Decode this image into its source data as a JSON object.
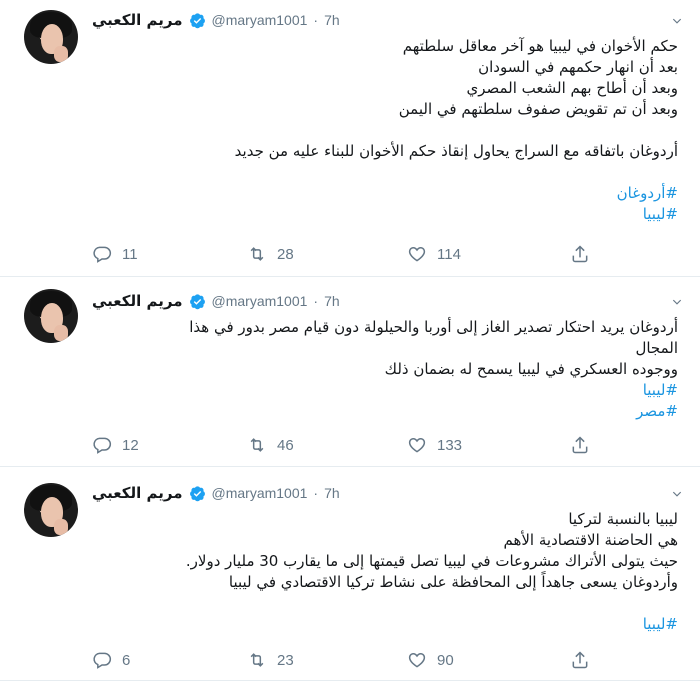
{
  "tweets": [
    {
      "author": {
        "name": "مريم الكعبي",
        "handle": "@maryam1001",
        "time": "7h"
      },
      "lines": [
        "حكم الأخوان في ليبيا هو آخر معاقل سلطتهم",
        "بعد أن انهار حكمهم في السودان",
        "وبعد أن أطاح بهم الشعب المصري",
        "وبعد أن تم تقويض صفوف سلطتهم في اليمن",
        "",
        "أردوغان باتفاقه مع السراج يحاول إنقاذ حكم الأخوان للبناء عليه من جديد",
        ""
      ],
      "hashtags": [
        "#أردوغان",
        "#ليبيا"
      ],
      "counts": {
        "replies": "11",
        "retweets": "28",
        "likes": "114"
      }
    },
    {
      "author": {
        "name": "مريم الكعبي",
        "handle": "@maryam1001",
        "time": "7h"
      },
      "lines": [
        "أردوغان يريد احتكار تصدير الغاز إلى أوربا والحيلولة دون قيام مصر بدور في هذا",
        "المجال",
        "ووجوده العسكري في ليبيا يسمح له بضمان ذلك"
      ],
      "hashtags": [
        "#ليبيا",
        "#مصر"
      ],
      "counts": {
        "replies": "12",
        "retweets": "46",
        "likes": "133"
      }
    },
    {
      "author": {
        "name": "مريم الكعبي",
        "handle": "@maryam1001",
        "time": "7h"
      },
      "lines": [
        "ليبيا بالنسبة لتركيا",
        "هي الحاضنة الاقتصادية الأهم",
        "حيث يتولى الأتراك مشروعات في ليبيا تصل قيمتها إلى ما يقارب 30 مليار دولار.",
        "وأردوغان يسعى جاهداً إلى المحافظة على نشاط تركيا الاقتصادي في ليبيا",
        ""
      ],
      "hashtags": [
        "#ليبيا"
      ],
      "counts": {
        "replies": "6",
        "retweets": "23",
        "likes": "90"
      }
    }
  ],
  "colors": {
    "accent": "#1b95e0",
    "muted": "#657786",
    "text": "#14171a",
    "border": "#e6ecf0",
    "verified": "#1da1f2"
  },
  "icons": {
    "reply": "reply-icon",
    "retweet": "retweet-icon",
    "like": "heart-icon",
    "share": "share-icon",
    "verified": "verified-badge-icon",
    "caret": "chevron-down-icon"
  }
}
